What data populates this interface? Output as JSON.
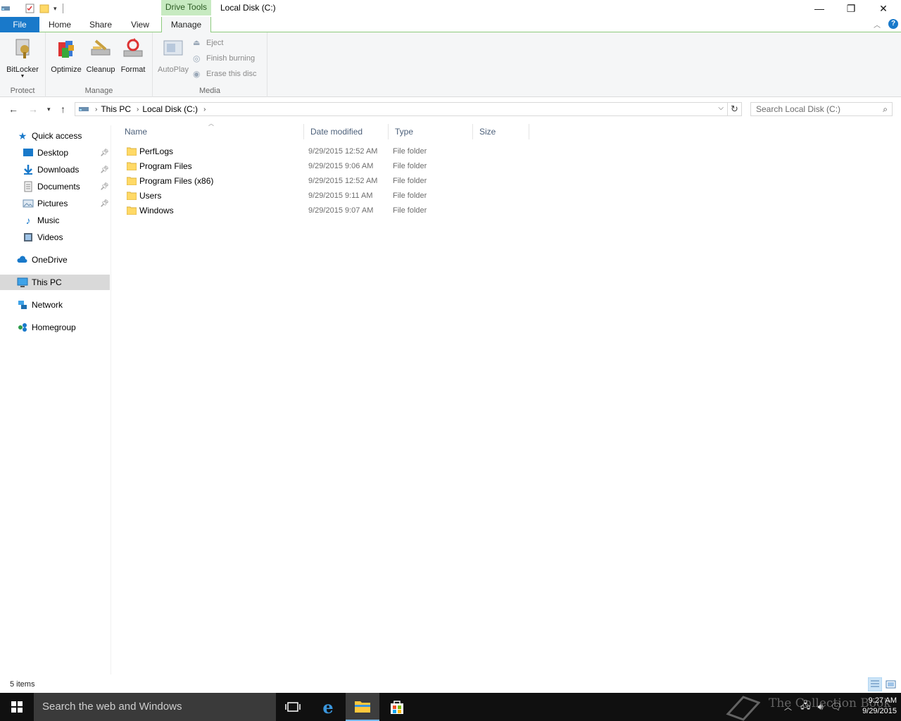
{
  "window": {
    "title": "Local Disk (C:)",
    "context_tab": "Drive Tools",
    "minimize_glyph": "—",
    "restore_glyph": "❐",
    "close_glyph": "✕"
  },
  "ribbon": {
    "tabs": [
      "File",
      "Home",
      "Share",
      "View",
      "Manage"
    ],
    "groups": {
      "protect": {
        "label": "Protect",
        "bitlocker_label": "BitLocker"
      },
      "manage": {
        "label": "Manage",
        "optimize_label": "Optimize",
        "cleanup_label": "Cleanup",
        "format_label": "Format"
      },
      "media": {
        "label": "Media",
        "autoplay_label": "AutoPlay",
        "eject_label": "Eject",
        "finish_burning_label": "Finish burning",
        "erase_label": "Erase this disc"
      }
    }
  },
  "address": {
    "breadcrumbs": [
      "This PC",
      "Local Disk (C:)"
    ],
    "search_placeholder": "Search Local Disk (C:)"
  },
  "nav_pane": {
    "quick_access": "Quick access",
    "items": [
      {
        "label": "Desktop",
        "pinned": true,
        "icon": "desktop-icon"
      },
      {
        "label": "Downloads",
        "pinned": true,
        "icon": "downloads-icon"
      },
      {
        "label": "Documents",
        "pinned": true,
        "icon": "documents-icon"
      },
      {
        "label": "Pictures",
        "pinned": true,
        "icon": "pictures-icon"
      },
      {
        "label": "Music",
        "pinned": false,
        "icon": "music-icon"
      },
      {
        "label": "Videos",
        "pinned": false,
        "icon": "videos-icon"
      }
    ],
    "onedrive": "OneDrive",
    "this_pc": "This PC",
    "network": "Network",
    "homegroup": "Homegroup",
    "selected": "This PC"
  },
  "file_list": {
    "columns": [
      "Name",
      "Date modified",
      "Type",
      "Size"
    ],
    "rows": [
      {
        "name": "PerfLogs",
        "date": "9/29/2015 12:52 AM",
        "type": "File folder",
        "size": ""
      },
      {
        "name": "Program Files",
        "date": "9/29/2015 9:06 AM",
        "type": "File folder",
        "size": ""
      },
      {
        "name": "Program Files (x86)",
        "date": "9/29/2015 12:52 AM",
        "type": "File folder",
        "size": ""
      },
      {
        "name": "Users",
        "date": "9/29/2015 9:11 AM",
        "type": "File folder",
        "size": ""
      },
      {
        "name": "Windows",
        "date": "9/29/2015 9:07 AM",
        "type": "File folder",
        "size": ""
      }
    ]
  },
  "status_bar": {
    "item_count": "5 items"
  },
  "taskbar": {
    "search_text": "Search the web and Windows",
    "time": "9:27 AM",
    "date": "9/29/2015",
    "watermark": "The Collection Book"
  },
  "colors": {
    "accent": "#1979ca",
    "context_tab": "#c7eac1",
    "selection": "#d9d9d9",
    "taskbar": "#101010"
  }
}
